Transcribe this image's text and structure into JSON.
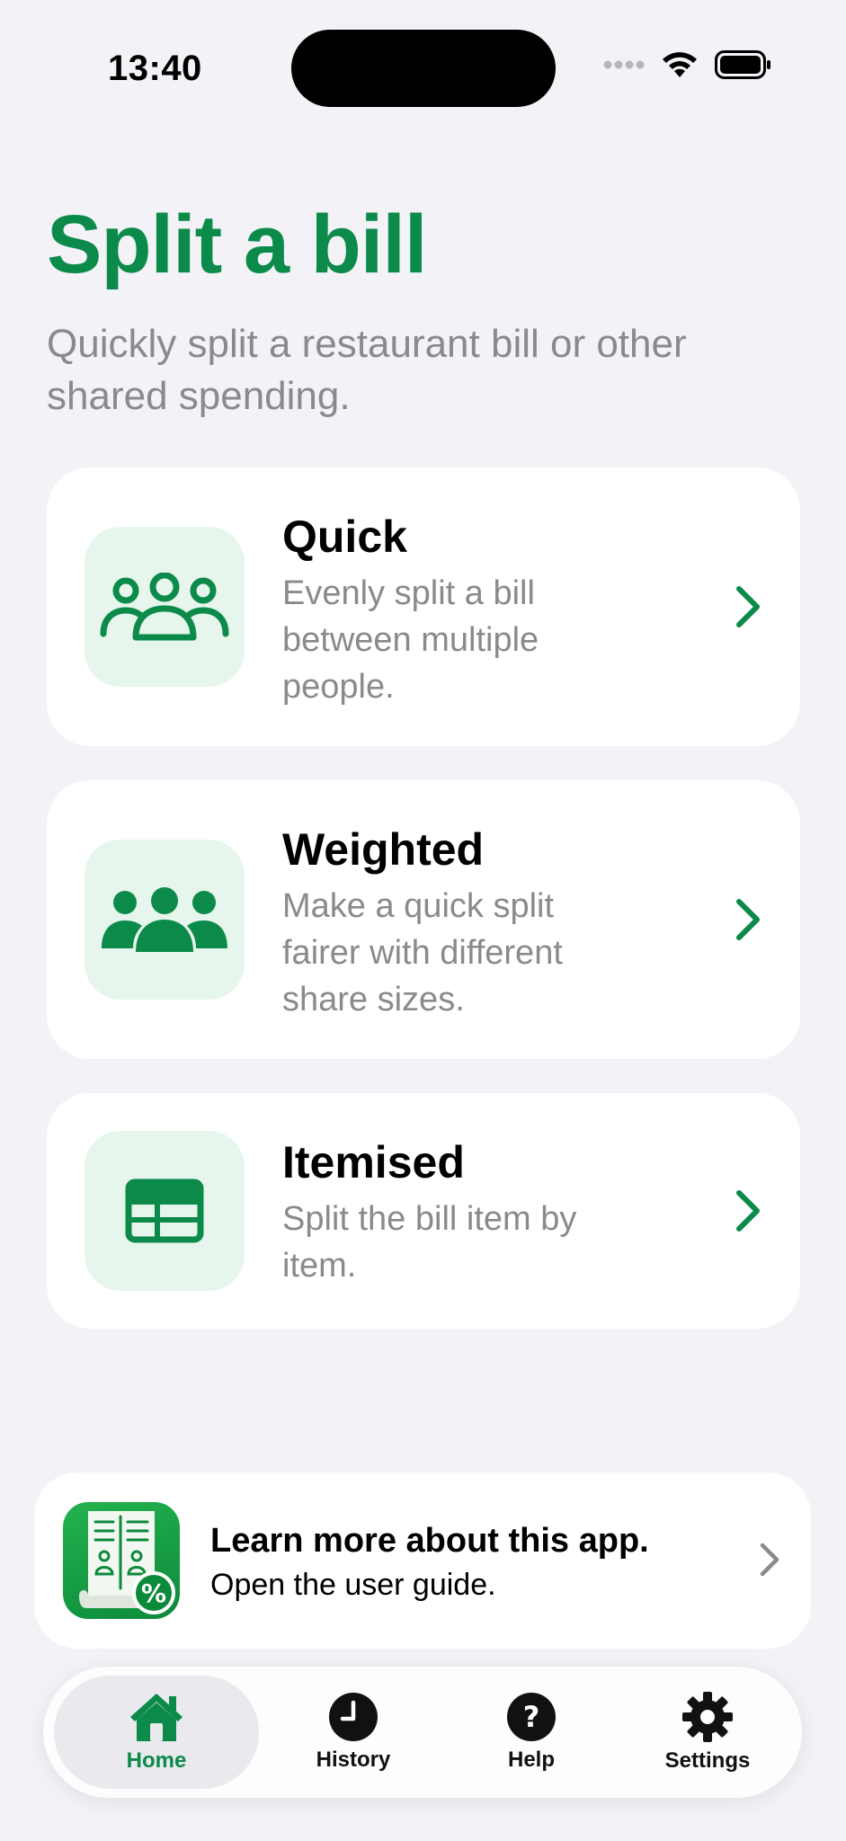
{
  "status_bar": {
    "time": "13:40",
    "icons": [
      "cellular-icon",
      "wifi-icon",
      "battery-icon"
    ]
  },
  "header": {
    "title": "Split a bill",
    "subtitle": "Quickly split a restaurant bill or other shared spending."
  },
  "colors": {
    "accent": "#0b8a4a",
    "icon_tile": "#e6f6ec",
    "background": "#f2f2f7",
    "secondary_text": "#8a8a8e"
  },
  "cards": [
    {
      "title": "Quick",
      "description": "Evenly split a bill between multiple people.",
      "icon": "people-outline-icon"
    },
    {
      "title": "Weighted",
      "description": "Make a quick split fairer with different share sizes.",
      "icon": "people-filled-icon"
    },
    {
      "title": "Itemised",
      "description": "Split the bill item by item.",
      "icon": "table-icon"
    }
  ],
  "guide": {
    "title": "Learn more about this app.",
    "subtitle": "Open the user guide.",
    "icon": "app-icon"
  },
  "tabs": [
    {
      "label": "Home",
      "icon": "house-icon",
      "active": true
    },
    {
      "label": "History",
      "icon": "clock-icon",
      "active": false
    },
    {
      "label": "Help",
      "icon": "question-icon",
      "active": false
    },
    {
      "label": "Settings",
      "icon": "gear-icon",
      "active": false
    }
  ]
}
